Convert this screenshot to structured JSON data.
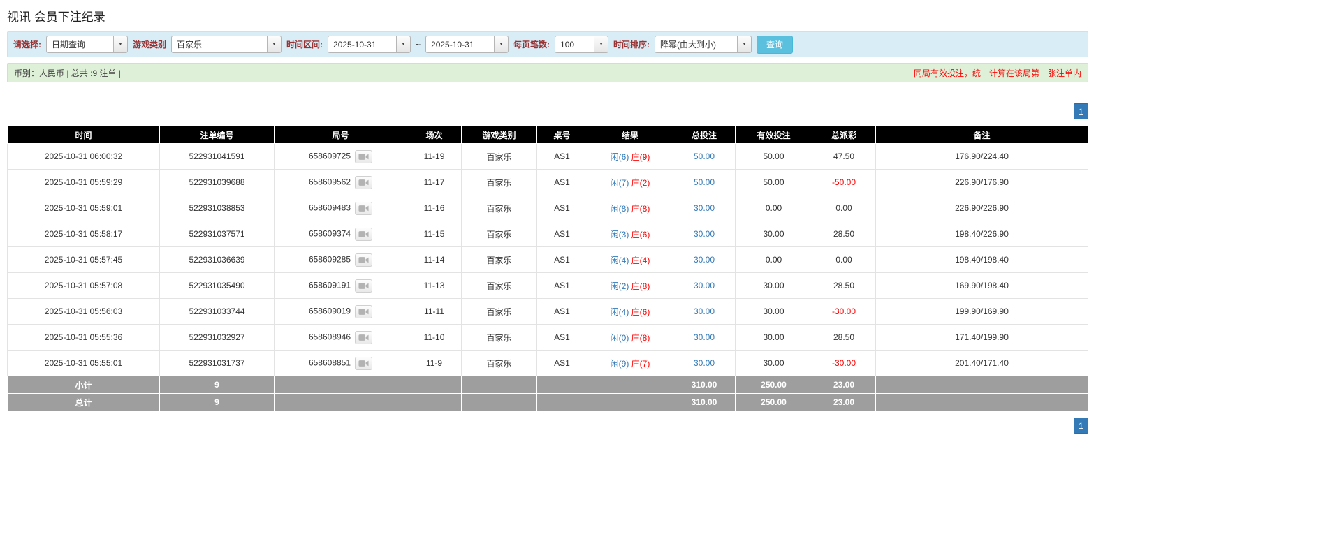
{
  "page": {
    "title": "视讯 会员下注纪录"
  },
  "icons": {
    "dropdown": "▼",
    "video_replay": "video-camera-icon"
  },
  "colors": {
    "link_blue": "#337ab7",
    "negative_red": "#ff0000",
    "header_bg": "#000000",
    "summary_bg": "#9e9e9e",
    "filter_bar_bg": "#d9edf7",
    "info_bar_bg": "#dff0d8",
    "search_button_bg": "#5bc0de",
    "pager_bg": "#337ab7"
  },
  "filters": {
    "select_label": "请选择:",
    "select_value": "日期查询",
    "game_label": "游戏类别",
    "game_value": "百家乐",
    "range_label": "时间区间:",
    "date_from": "2025-10-31",
    "range_separator": "~",
    "date_to": "2025-10-31",
    "page_size_label": "每页笔数:",
    "page_size_value": "100",
    "sort_label": "时间排序:",
    "sort_value": "降幂(由大到小)",
    "search_button": "查询"
  },
  "info_bar": {
    "summary": "币别：人民币 | 总共 :9 注单 |",
    "notice": "同局有效投注，统一计算在该局第一张注单内"
  },
  "pagination": {
    "current_page": "1"
  },
  "table": {
    "headers": [
      "时间",
      "注单编号",
      "局号",
      "场次",
      "游戏类别",
      "桌号",
      "结果",
      "总投注",
      "有效投注",
      "总派彩",
      "备注"
    ],
    "rows": [
      {
        "time": "2025-10-31 06:00:32",
        "bet_id": "522931041591",
        "round_id": "658609725",
        "session": "11-19",
        "game_type": "百家乐",
        "table_no": "AS1",
        "result_player": "闲(6)",
        "result_banker": "庄(9)",
        "total_bet": "50.00",
        "valid_bet": "50.00",
        "payout": "47.50",
        "remark": "176.90/224.40"
      },
      {
        "time": "2025-10-31 05:59:29",
        "bet_id": "522931039688",
        "round_id": "658609562",
        "session": "11-17",
        "game_type": "百家乐",
        "table_no": "AS1",
        "result_player": "闲(7)",
        "result_banker": "庄(2)",
        "total_bet": "50.00",
        "valid_bet": "50.00",
        "payout": "-50.00",
        "remark": "226.90/176.90"
      },
      {
        "time": "2025-10-31 05:59:01",
        "bet_id": "522931038853",
        "round_id": "658609483",
        "session": "11-16",
        "game_type": "百家乐",
        "table_no": "AS1",
        "result_player": "闲(8)",
        "result_banker": "庄(8)",
        "total_bet": "30.00",
        "valid_bet": "0.00",
        "payout": "0.00",
        "remark": "226.90/226.90"
      },
      {
        "time": "2025-10-31 05:58:17",
        "bet_id": "522931037571",
        "round_id": "658609374",
        "session": "11-15",
        "game_type": "百家乐",
        "table_no": "AS1",
        "result_player": "闲(3)",
        "result_banker": "庄(6)",
        "total_bet": "30.00",
        "valid_bet": "30.00",
        "payout": "28.50",
        "remark": "198.40/226.90"
      },
      {
        "time": "2025-10-31 05:57:45",
        "bet_id": "522931036639",
        "round_id": "658609285",
        "session": "11-14",
        "game_type": "百家乐",
        "table_no": "AS1",
        "result_player": "闲(4)",
        "result_banker": "庄(4)",
        "total_bet": "30.00",
        "valid_bet": "0.00",
        "payout": "0.00",
        "remark": "198.40/198.40"
      },
      {
        "time": "2025-10-31 05:57:08",
        "bet_id": "522931035490",
        "round_id": "658609191",
        "session": "11-13",
        "game_type": "百家乐",
        "table_no": "AS1",
        "result_player": "闲(2)",
        "result_banker": "庄(8)",
        "total_bet": "30.00",
        "valid_bet": "30.00",
        "payout": "28.50",
        "remark": "169.90/198.40"
      },
      {
        "time": "2025-10-31 05:56:03",
        "bet_id": "522931033744",
        "round_id": "658609019",
        "session": "11-11",
        "game_type": "百家乐",
        "table_no": "AS1",
        "result_player": "闲(4)",
        "result_banker": "庄(6)",
        "total_bet": "30.00",
        "valid_bet": "30.00",
        "payout": "-30.00",
        "remark": "199.90/169.90"
      },
      {
        "time": "2025-10-31 05:55:36",
        "bet_id": "522931032927",
        "round_id": "658608946",
        "session": "11-10",
        "game_type": "百家乐",
        "table_no": "AS1",
        "result_player": "闲(0)",
        "result_banker": "庄(8)",
        "total_bet": "30.00",
        "valid_bet": "30.00",
        "payout": "28.50",
        "remark": "171.40/199.90"
      },
      {
        "time": "2025-10-31 05:55:01",
        "bet_id": "522931031737",
        "round_id": "658608851",
        "session": "11-9",
        "game_type": "百家乐",
        "table_no": "AS1",
        "result_player": "闲(9)",
        "result_banker": "庄(7)",
        "total_bet": "30.00",
        "valid_bet": "30.00",
        "payout": "-30.00",
        "remark": "201.40/171.40"
      }
    ],
    "summary_rows": [
      {
        "label": "小计",
        "count": "9",
        "total_bet": "310.00",
        "valid_bet": "250.00",
        "payout": "23.00"
      },
      {
        "label": "总计",
        "count": "9",
        "total_bet": "310.00",
        "valid_bet": "250.00",
        "payout": "23.00"
      }
    ]
  }
}
